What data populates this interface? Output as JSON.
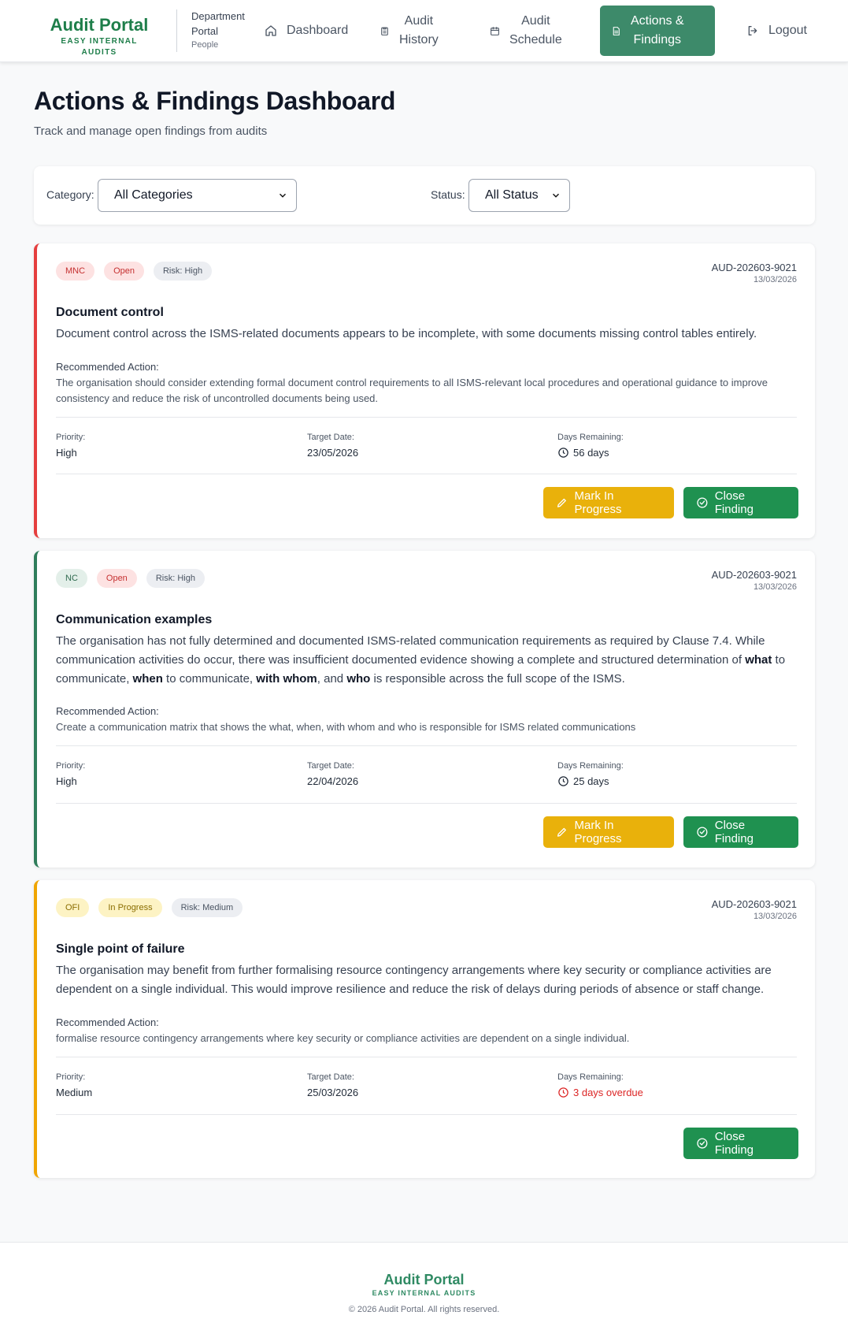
{
  "header": {
    "logo_title": "Audit Portal",
    "logo_sub": "EASY INTERNAL AUDITS",
    "dept_line1": "Department",
    "dept_line2": "Portal",
    "dept_sub": "People",
    "nav": {
      "dashboard": "Dashboard",
      "history_1": "Audit",
      "history_2": "History",
      "schedule_1": "Audit",
      "schedule_2": "Schedule",
      "actions_1": "Actions &",
      "actions_2": "Findings",
      "logout": "Logout"
    }
  },
  "page": {
    "title": "Actions & Findings Dashboard",
    "subtitle": "Track and manage open findings from audits"
  },
  "filters": {
    "category_label": "Category:",
    "category_value": "All Categories",
    "status_label": "Status:",
    "status_value": "All Status"
  },
  "labels": {
    "recommended": "Recommended Action:",
    "priority": "Priority:",
    "target": "Target Date:",
    "days": "Days Remaining:",
    "mark_in_progress": "Mark In Progress",
    "close_finding": "Close Finding"
  },
  "findings": [
    {
      "type": "MNC",
      "status": "Open",
      "risk": "Risk: High",
      "audit_id": "AUD-202603-9021",
      "audit_date": "13/03/2026",
      "title": "Document control",
      "description": "Document control across the ISMS-related documents appears to be incomplete, with some documents missing control tables entirely.",
      "recommended_action": "The organisation should consider extending formal document control requirements to all ISMS-relevant local procedures and operational guidance to improve consistency and reduce the risk of uncontrolled documents being used.",
      "priority": "High",
      "target_date": "23/05/2026",
      "days_remaining": "56 days",
      "accent": "#e53e3e"
    },
    {
      "type": "NC",
      "status": "Open",
      "risk": "Risk: High",
      "audit_id": "AUD-202603-9021",
      "audit_date": "13/03/2026",
      "title": "Communication examples",
      "description_parts": {
        "p1": "The organisation has not fully determined and documented ISMS-related communication requirements as required by Clause 7.4. While communication activities do occur, there was insufficient documented evidence showing a complete and structured determination of ",
        "b1": "what",
        "p2": " to communicate, ",
        "b2": "when",
        "p3": " to communicate, ",
        "b3": "with whom",
        "p4": ", and ",
        "b4": "who",
        "p5": " is responsible across the full scope of the ISMS."
      },
      "recommended_action": "Create a communication matrix that shows the what, when, with whom and who is responsible for ISMS related communications",
      "priority": "High",
      "target_date": "22/04/2026",
      "days_remaining": "25 days",
      "accent": "#2f7d5b"
    },
    {
      "type": "OFI",
      "status": "In Progress",
      "risk": "Risk: Medium",
      "audit_id": "AUD-202603-9021",
      "audit_date": "13/03/2026",
      "title": "Single point of failure",
      "description": "The organisation may benefit from further formalising resource contingency arrangements where key security or compliance activities are dependent on a single individual. This would improve resilience and reduce the risk of delays during periods of absence or staff change.",
      "recommended_action": "formalise resource contingency arrangements where key security or compliance activities are dependent on a single individual.",
      "priority": "Medium",
      "target_date": "25/03/2026",
      "days_remaining": "3 days overdue",
      "accent": "#f0a500"
    }
  ],
  "footer": {
    "title": "Audit Portal",
    "sub": "EASY INTERNAL AUDITS",
    "copyright": "© 2026 Audit Portal. All rights reserved."
  }
}
